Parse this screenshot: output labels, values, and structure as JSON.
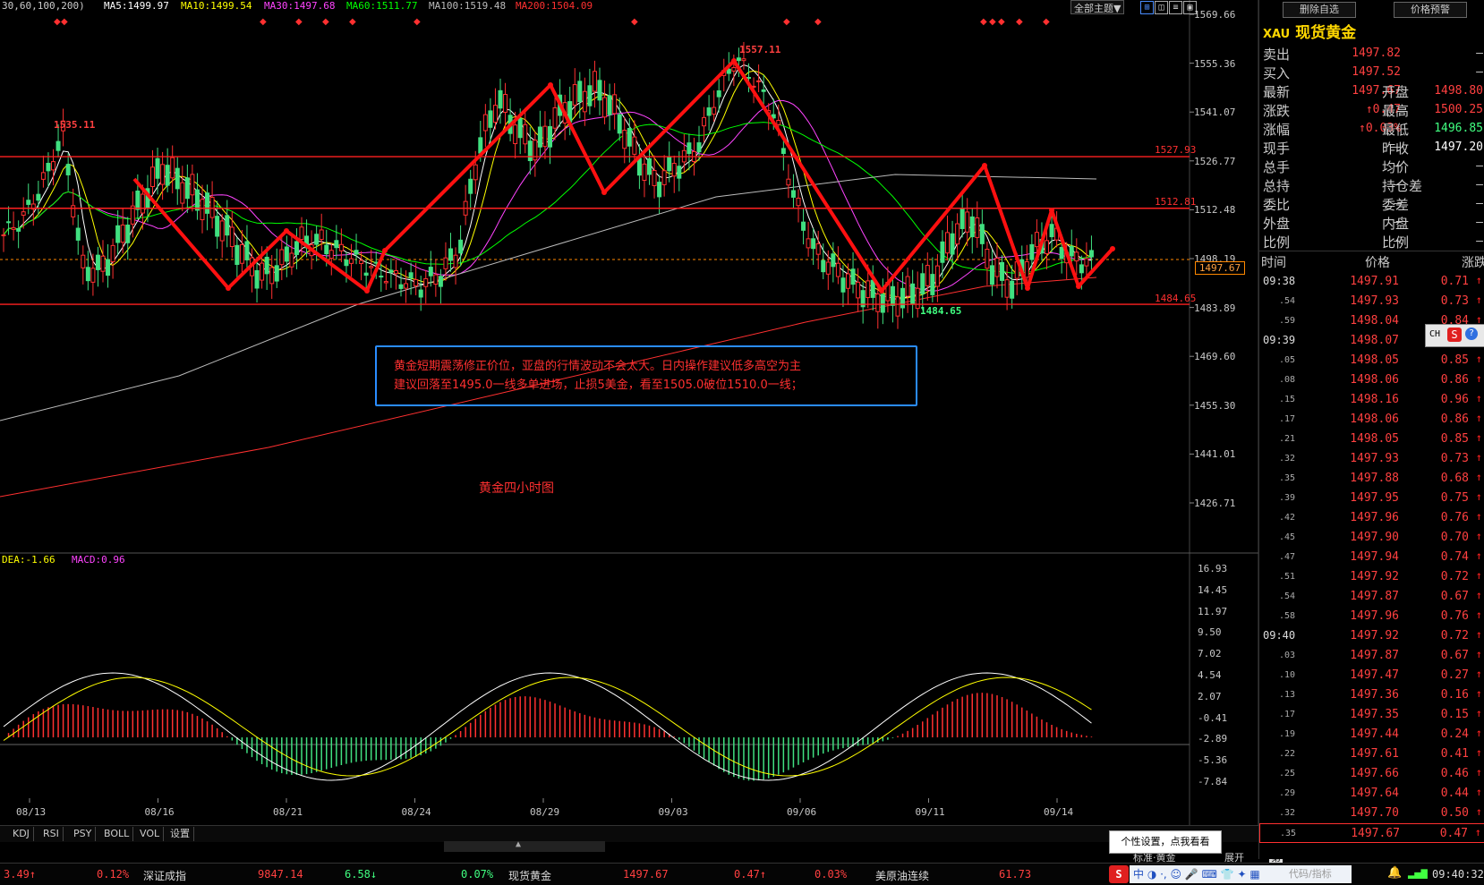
{
  "ma_header": {
    "prefix": "30,60,100,200)",
    "ma5": "MA5:1499.97",
    "ma10": "MA10:1499.54",
    "ma30": "MA30:1497.68",
    "ma60": "MA60:1511.77",
    "ma100": "MA100:1519.48",
    "ma200": "MA200:1504.09"
  },
  "toolbar": {
    "theme_label": "全部主题▼"
  },
  "price_axis": [
    "1569.66",
    "1555.36",
    "1541.07",
    "1526.77",
    "1512.48",
    "1498.19",
    "1483.89",
    "1469.60",
    "1455.30",
    "1441.01",
    "1426.71"
  ],
  "current_price_tag": "1497.67",
  "levels": {
    "l1": "1527.93",
    "l2": "1512.81",
    "l3": "1484.65"
  },
  "peak_labels": {
    "p1": "1535.11",
    "p2": "1557.11",
    "p3": "1484.65"
  },
  "annotation": {
    "line1": "黄金短期震荡修正价位，亚盘的行情波动不会太大。日内操作建议低多高空为主",
    "line2": "建议回落至1495.0一线多单进场，止损5美金，看至1505.0破位1510.0一线；"
  },
  "chart_caption": "黄金四小时图",
  "macd_header": {
    "dea": "DEA:-1.66",
    "macd": "MACD:0.96"
  },
  "macd_axis": [
    "16.93",
    "14.45",
    "11.97",
    "9.50",
    "7.02",
    "4.54",
    "2.07",
    "-0.41",
    "-2.89",
    "-5.36",
    "-7.84"
  ],
  "date_axis": [
    "08/13",
    "08/16",
    "08/21",
    "08/24",
    "08/29",
    "09/03",
    "09/06",
    "09/11",
    "09/14"
  ],
  "indicator_tabs": [
    "KDJ",
    "RSI",
    "PSY",
    "BOLL",
    "VOL",
    "设置"
  ],
  "right_panel": {
    "btn_delete": "删除自选",
    "btn_alert": "价格预警",
    "code": "XAU",
    "name": "现货黄金",
    "rows": [
      {
        "l1": "卖出",
        "v1": "1497.82",
        "l2": "",
        "v2": "—"
      },
      {
        "l1": "买入",
        "v1": "1497.52",
        "l2": "",
        "v2": "—"
      },
      {
        "l1": "最新",
        "v1": "1497.67",
        "l2": "开盘",
        "v2": "1498.80"
      },
      {
        "l1": "涨跌",
        "v1": "↑0.47",
        "l2": "最高",
        "v2": "1500.25"
      },
      {
        "l1": "涨幅",
        "v1": "↑0.03%",
        "l2": "最低",
        "v2": "1496.85"
      },
      {
        "l1": "现手",
        "v1": "—",
        "l2": "昨收",
        "v2": "1497.20"
      },
      {
        "l1": "总手",
        "v1": "—",
        "l2": "均价",
        "v2": "—"
      },
      {
        "l1": "总持",
        "v1": "—",
        "l2": "持仓差",
        "v2": "—"
      },
      {
        "l1": "委比",
        "v1": "—",
        "l2": "委差",
        "v2": "—"
      },
      {
        "l1": "外盘",
        "v1": "—",
        "l2": "内盘",
        "v2": "—"
      },
      {
        "l1": "比例",
        "v1": "—",
        "l2": "比例",
        "v2": "—"
      }
    ],
    "tick_headers": {
      "time": "时间",
      "price": "价格",
      "change": "涨跌"
    },
    "ticks": [
      {
        "t": "09:38",
        "p": "1497.91",
        "c": "0.71"
      },
      {
        "t": "54",
        "p": "1497.93",
        "c": "0.73"
      },
      {
        "t": "59",
        "p": "1498.04",
        "c": "0.84"
      },
      {
        "t": "09:39",
        "p": "1498.07",
        "c": "0.87"
      },
      {
        "t": "05",
        "p": "1498.05",
        "c": "0.85"
      },
      {
        "t": "08",
        "p": "1498.06",
        "c": "0.86"
      },
      {
        "t": "15",
        "p": "1498.16",
        "c": "0.96"
      },
      {
        "t": "17",
        "p": "1498.06",
        "c": "0.86"
      },
      {
        "t": "21",
        "p": "1498.05",
        "c": "0.85"
      },
      {
        "t": "32",
        "p": "1497.93",
        "c": "0.73"
      },
      {
        "t": "35",
        "p": "1497.88",
        "c": "0.68"
      },
      {
        "t": "39",
        "p": "1497.95",
        "c": "0.75"
      },
      {
        "t": "42",
        "p": "1497.96",
        "c": "0.76"
      },
      {
        "t": "45",
        "p": "1497.90",
        "c": "0.70"
      },
      {
        "t": "47",
        "p": "1497.94",
        "c": "0.74"
      },
      {
        "t": "51",
        "p": "1497.92",
        "c": "0.72"
      },
      {
        "t": "54",
        "p": "1497.87",
        "c": "0.67"
      },
      {
        "t": "58",
        "p": "1497.96",
        "c": "0.76"
      },
      {
        "t": "09:40",
        "p": "1497.92",
        "c": "0.72"
      },
      {
        "t": "03",
        "p": "1497.87",
        "c": "0.67"
      },
      {
        "t": "10",
        "p": "1497.47",
        "c": "0.27"
      },
      {
        "t": "13",
        "p": "1497.36",
        "c": "0.16"
      },
      {
        "t": "17",
        "p": "1497.35",
        "c": "0.15"
      },
      {
        "t": "19",
        "p": "1497.44",
        "c": "0.24"
      },
      {
        "t": "22",
        "p": "1497.61",
        "c": "0.41"
      },
      {
        "t": "25",
        "p": "1497.66",
        "c": "0.46"
      },
      {
        "t": "29",
        "p": "1497.64",
        "c": "0.44"
      },
      {
        "t": "32",
        "p": "1497.70",
        "c": "0.50"
      },
      {
        "t": "35",
        "p": "1497.67",
        "c": "0.47"
      }
    ],
    "float_toolbar": "CH"
  },
  "tooltip": "个性设置，点我看看",
  "bottom_right_tabs": {
    "standard": "标准·黄金",
    "expand": "展开",
    "more": "第"
  },
  "status_bar": {
    "item1_val": "3.49↑",
    "item1_pct": "0.12%",
    "item2_name": "深证成指",
    "item2_val": "9847.14",
    "item2_chg": "6.58↓",
    "item2_pct": "0.07%",
    "item3_name": "现货黄金",
    "item3_val": "1497.67",
    "item3_chg": "0.47↑",
    "item3_pct": "0.03%",
    "item4_name": "美原油连续",
    "item4_val": "61.73",
    "ime_label": "中",
    "search_hint": "代码/指标",
    "clock": "09:40:32"
  }
}
